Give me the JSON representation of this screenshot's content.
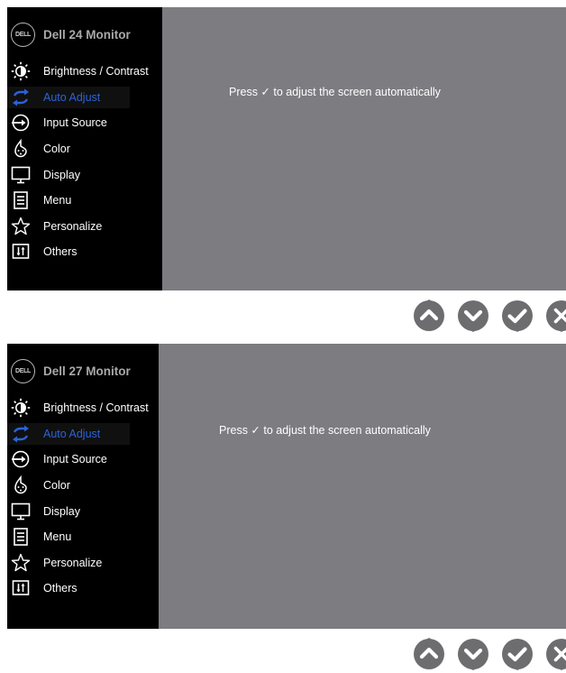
{
  "monitors": [
    {
      "logo": "DELL",
      "title": "Dell 24 Monitor",
      "message": "Press ✓ to adjust the screen automatically",
      "menu": [
        {
          "label": "Brightness / Contrast",
          "icon": "brightness-icon"
        },
        {
          "label": "Auto Adjust",
          "icon": "auto-adjust-icon",
          "selected": true
        },
        {
          "label": "Input Source",
          "icon": "input-source-icon"
        },
        {
          "label": "Color",
          "icon": "color-icon"
        },
        {
          "label": "Display",
          "icon": "display-icon"
        },
        {
          "label": "Menu",
          "icon": "menu-icon"
        },
        {
          "label": "Personalize",
          "icon": "star-icon"
        },
        {
          "label": "Others",
          "icon": "others-icon"
        }
      ]
    },
    {
      "logo": "DELL",
      "title": "Dell 27 Monitor",
      "message": "Press ✓ to adjust the screen automatically",
      "menu": [
        {
          "label": "Brightness / Contrast",
          "icon": "brightness-icon"
        },
        {
          "label": "Auto Adjust",
          "icon": "auto-adjust-icon",
          "selected": true
        },
        {
          "label": "Input Source",
          "icon": "input-source-icon"
        },
        {
          "label": "Color",
          "icon": "color-icon"
        },
        {
          "label": "Display",
          "icon": "display-icon"
        },
        {
          "label": "Menu",
          "icon": "menu-icon"
        },
        {
          "label": "Personalize",
          "icon": "star-icon"
        },
        {
          "label": "Others",
          "icon": "others-icon"
        }
      ]
    }
  ],
  "buttons": [
    "up-button",
    "down-button",
    "check-button",
    "exit-button"
  ],
  "colors": {
    "sidebar": "#000000",
    "panel": "#7d7c81",
    "selected_text": "#2b63d9",
    "button": "#6d6d70",
    "title_text": "#a9a9a9"
  }
}
